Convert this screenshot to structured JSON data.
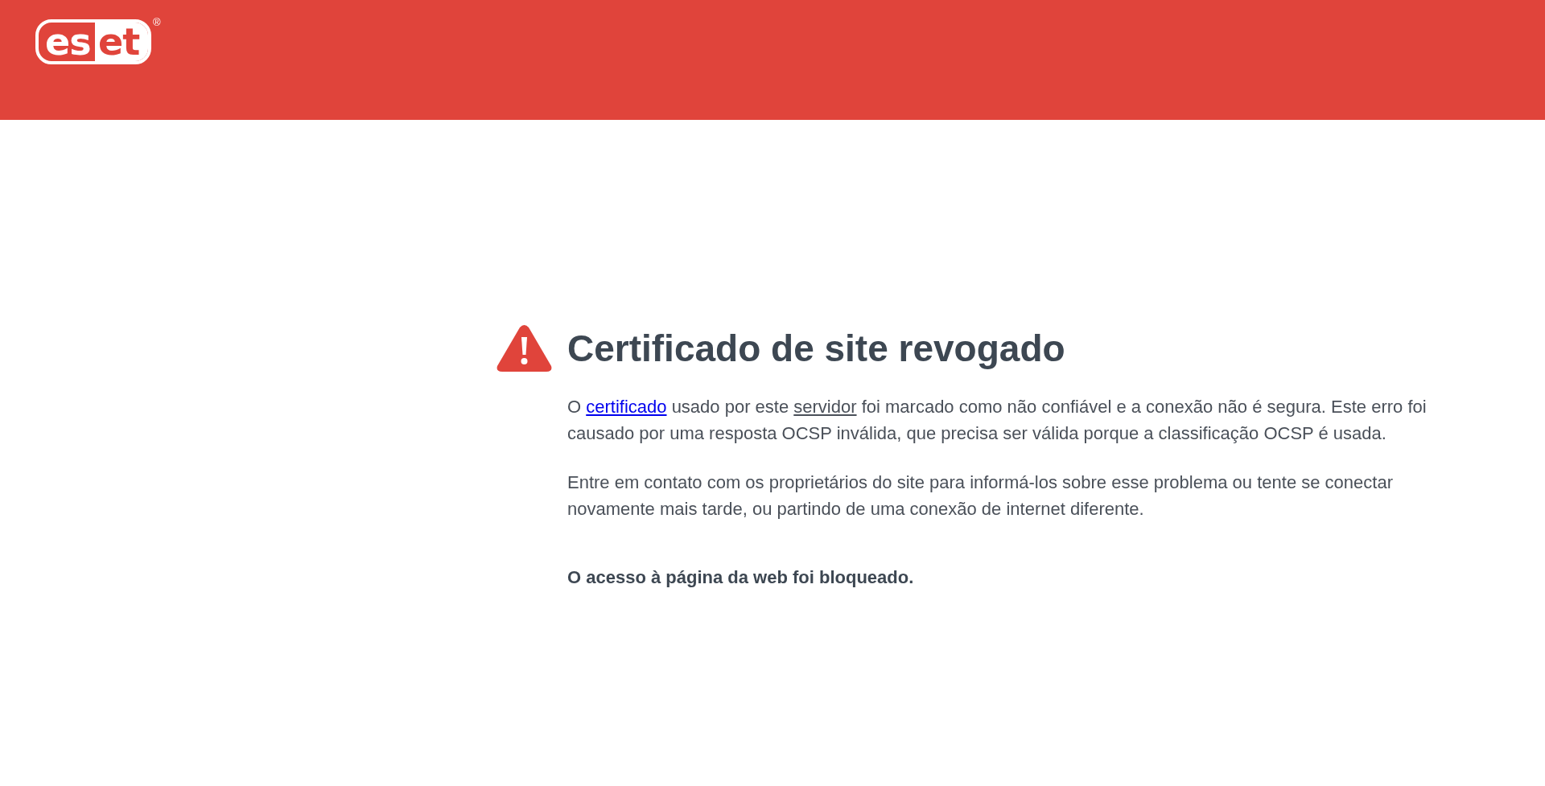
{
  "header": {
    "logo": {
      "text": "eset",
      "mark": "®"
    }
  },
  "message": {
    "title": "Certificado de site revogado",
    "paragraphs": [
      {
        "parts": [
          {
            "kind": "text",
            "text": "O "
          },
          {
            "kind": "link",
            "text": "certificado"
          },
          {
            "kind": "text",
            "text": " usado por este "
          },
          {
            "kind": "term",
            "text": "servidor"
          },
          {
            "kind": "text",
            "text": " foi marcado como não confiável e a conexão não é segura. Este erro foi causado por uma resposta OCSP inválida, que precisa ser válida porque a classificação OCSP é usada."
          }
        ]
      },
      {
        "parts": [
          {
            "kind": "text",
            "text": "Entre em contato com os proprietários do site para informá-los sobre esse problema ou tente se conectar novamente mais tarde, ou partindo de uma conexão de internet diferente."
          }
        ]
      }
    ],
    "verdict": "O acesso à página da web foi bloqueado."
  }
}
